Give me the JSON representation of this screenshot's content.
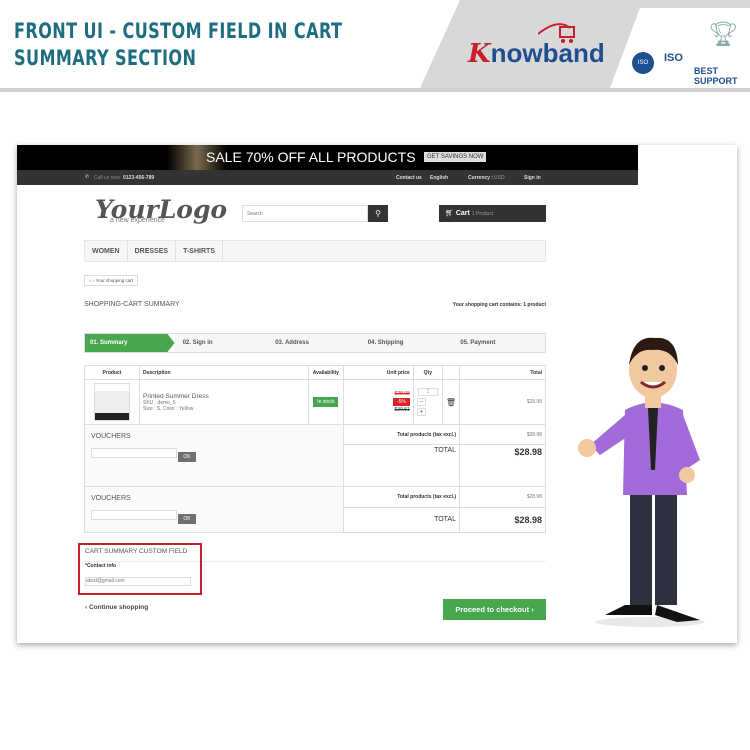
{
  "header": {
    "title_line1": "FRONT UI - CUSTOM FIELD IN CART",
    "title_line2": "SUMMARY SECTION",
    "brand": "nowband",
    "brand_k": "K",
    "badges": [
      "ISO",
      "ISO"
    ],
    "support": "BEST SUPPORT"
  },
  "shop": {
    "banner": {
      "text": "SALE 70% OFF ALL PRODUCTS",
      "cta": "GET SAVINGS NOW"
    },
    "topnav": {
      "call_label": "Call us now:",
      "phone": "0123-456-789",
      "contact": "Contact us",
      "language": "English",
      "currency_label": "Currency :",
      "currency": "USD",
      "signin": "Sign in"
    },
    "logo": {
      "main": "YourLogo",
      "tag": "a new experience"
    },
    "search": {
      "placeholder": "Search"
    },
    "cart": {
      "label": "Cart",
      "count": "1 Product"
    },
    "menu": [
      "WOMEN",
      "DRESSES",
      "T-SHIRTS"
    ],
    "breadcrumb": "Your shopping cart",
    "page_title": "SHOPPING-CART SUMMARY",
    "contains": "Your shopping cart contains: 1 product",
    "steps": [
      "01. Summary",
      "02. Sign in",
      "03. Address",
      "04. Shipping",
      "05. Payment"
    ],
    "columns": [
      "Product",
      "Description",
      "Availability",
      "Unit price",
      "Qty",
      "",
      "Total"
    ],
    "item": {
      "name": "Printed Summer Dress",
      "sku": "SKU : demo_5",
      "attrs": "Size : S, Color : Yellow",
      "availability": "In stock",
      "price": "$28.98",
      "discount": "-5%",
      "old_price": "$30.51",
      "qty": "1",
      "total": "$28.98"
    },
    "vouchers": "VOUCHERS",
    "ok": "OK",
    "total_products_label": "Total products (tax excl.)",
    "total_products": "$28.98",
    "total_label": "TOTAL",
    "total": "$28.98",
    "custom_field": {
      "title": "CART SUMMARY CUSTOM FIELD",
      "label": "*Contact info",
      "placeholder": "abcd@gmail.com"
    },
    "continue": "Continue shopping",
    "checkout": "Proceed to checkout"
  },
  "colors": {
    "accent": "#46a74e",
    "title": "#1f6d80",
    "highlight": "#c8202a"
  }
}
